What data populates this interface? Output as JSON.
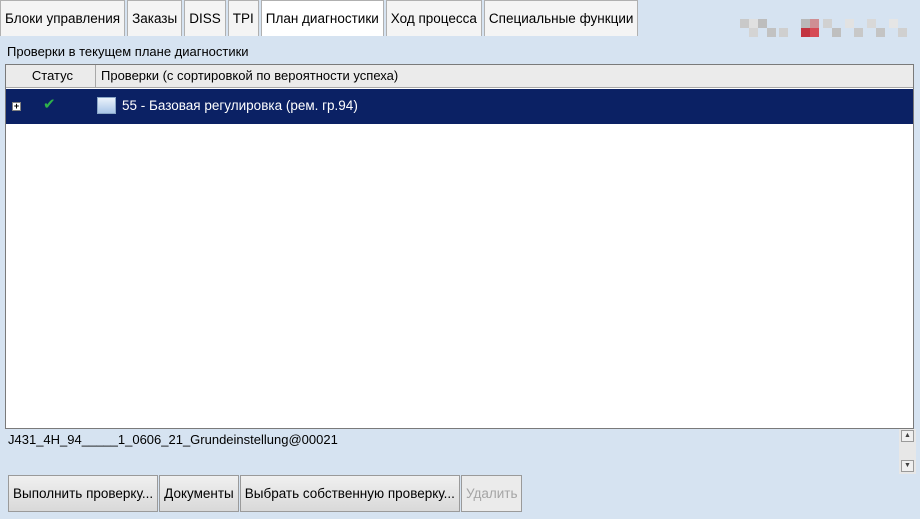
{
  "tabs": [
    {
      "label": "Блоки управления",
      "active": false
    },
    {
      "label": "Заказы",
      "active": false
    },
    {
      "label": "DISS",
      "active": false
    },
    {
      "label": "TPI",
      "active": false
    },
    {
      "label": "План диагностики",
      "active": true
    },
    {
      "label": "Ход процесса",
      "active": false
    },
    {
      "label": "Специальные функции",
      "active": false
    }
  ],
  "section_label": "Проверки в текущем плане диагностики",
  "table": {
    "columns": [
      "Статус",
      "Проверки (с сортировкой по вероятности успеха)"
    ],
    "rows": [
      {
        "expander": "+",
        "status_icon": "checkmark-icon",
        "icon": "document-icon",
        "text": "55 - Базовая регулировка (рем. гр.94)",
        "selected": true
      }
    ]
  },
  "info_text": "J431_4H_94_____1_0606_21_Grundeinstellung@00021",
  "buttons": {
    "run_check": "Выполнить проверку...",
    "documents": "Документы",
    "choose_own": "Выбрать собственную проверку...",
    "delete": "Удалить"
  },
  "colors": {
    "background": "#d6e3f1",
    "selected_row": "#0b2164",
    "check_green": "#2fb34a"
  }
}
